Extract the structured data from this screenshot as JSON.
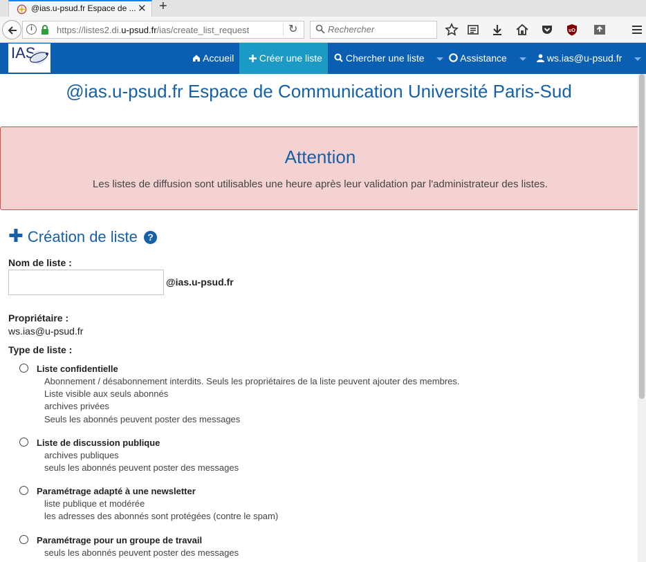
{
  "browser": {
    "tab_title": "@ias.u-psud.fr Espace de ...",
    "url_host": "https://listes2.di.",
    "url_domain": "u-psud.fr",
    "url_path": "/ias/create_list_request",
    "search_placeholder": "Rechercher"
  },
  "header": {
    "logo_text": "IAS",
    "nav": [
      {
        "label": "Accueil",
        "icon": "home-icon"
      },
      {
        "label": "Créer une liste",
        "icon": "plus-icon"
      },
      {
        "label": "Chercher une liste",
        "icon": "search-icon"
      },
      {
        "label": "Assistance",
        "icon": "lifebuoy-icon"
      },
      {
        "label": "ws.ias@u-psud.fr",
        "icon": "user-icon"
      }
    ]
  },
  "page": {
    "site_title": "@ias.u-psud.fr Espace de Communication Université Paris-Sud",
    "alert_title": "Attention",
    "alert_message": "Les listes de diffusion sont utilisables une heure après leur validation par l'administrateur des listes.",
    "section_title": "Création de liste",
    "list_name_label": "Nom de liste :",
    "list_name_value": "",
    "list_suffix": "@ias.u-psud.fr",
    "owner_label": "Propriétaire :",
    "owner_value": "ws.ias@u-psud.fr",
    "type_label": "Type de liste :",
    "options": [
      {
        "title": "Liste confidentielle",
        "lines": [
          "Abonnement / désabonnement interdits. Seuls les propriétaires de la liste peuvent ajouter des membres.",
          "Liste visible aux seuls abonnés",
          "archives privées",
          "Seuls les abonnés peuvent poster des messages"
        ]
      },
      {
        "title": "Liste de discussion publique",
        "lines": [
          "archives publiques",
          "seuls les abonnés peuvent poster des messages"
        ]
      },
      {
        "title": "Paramétrage adapté à une newsletter",
        "lines": [
          "liste publique et modérée",
          "les adresses des abonnés sont protégées (contre le spam)"
        ]
      },
      {
        "title": "Paramétrage pour un groupe de travail",
        "lines": [
          "seuls les abonnés peuvent poster des messages"
        ]
      }
    ]
  }
}
